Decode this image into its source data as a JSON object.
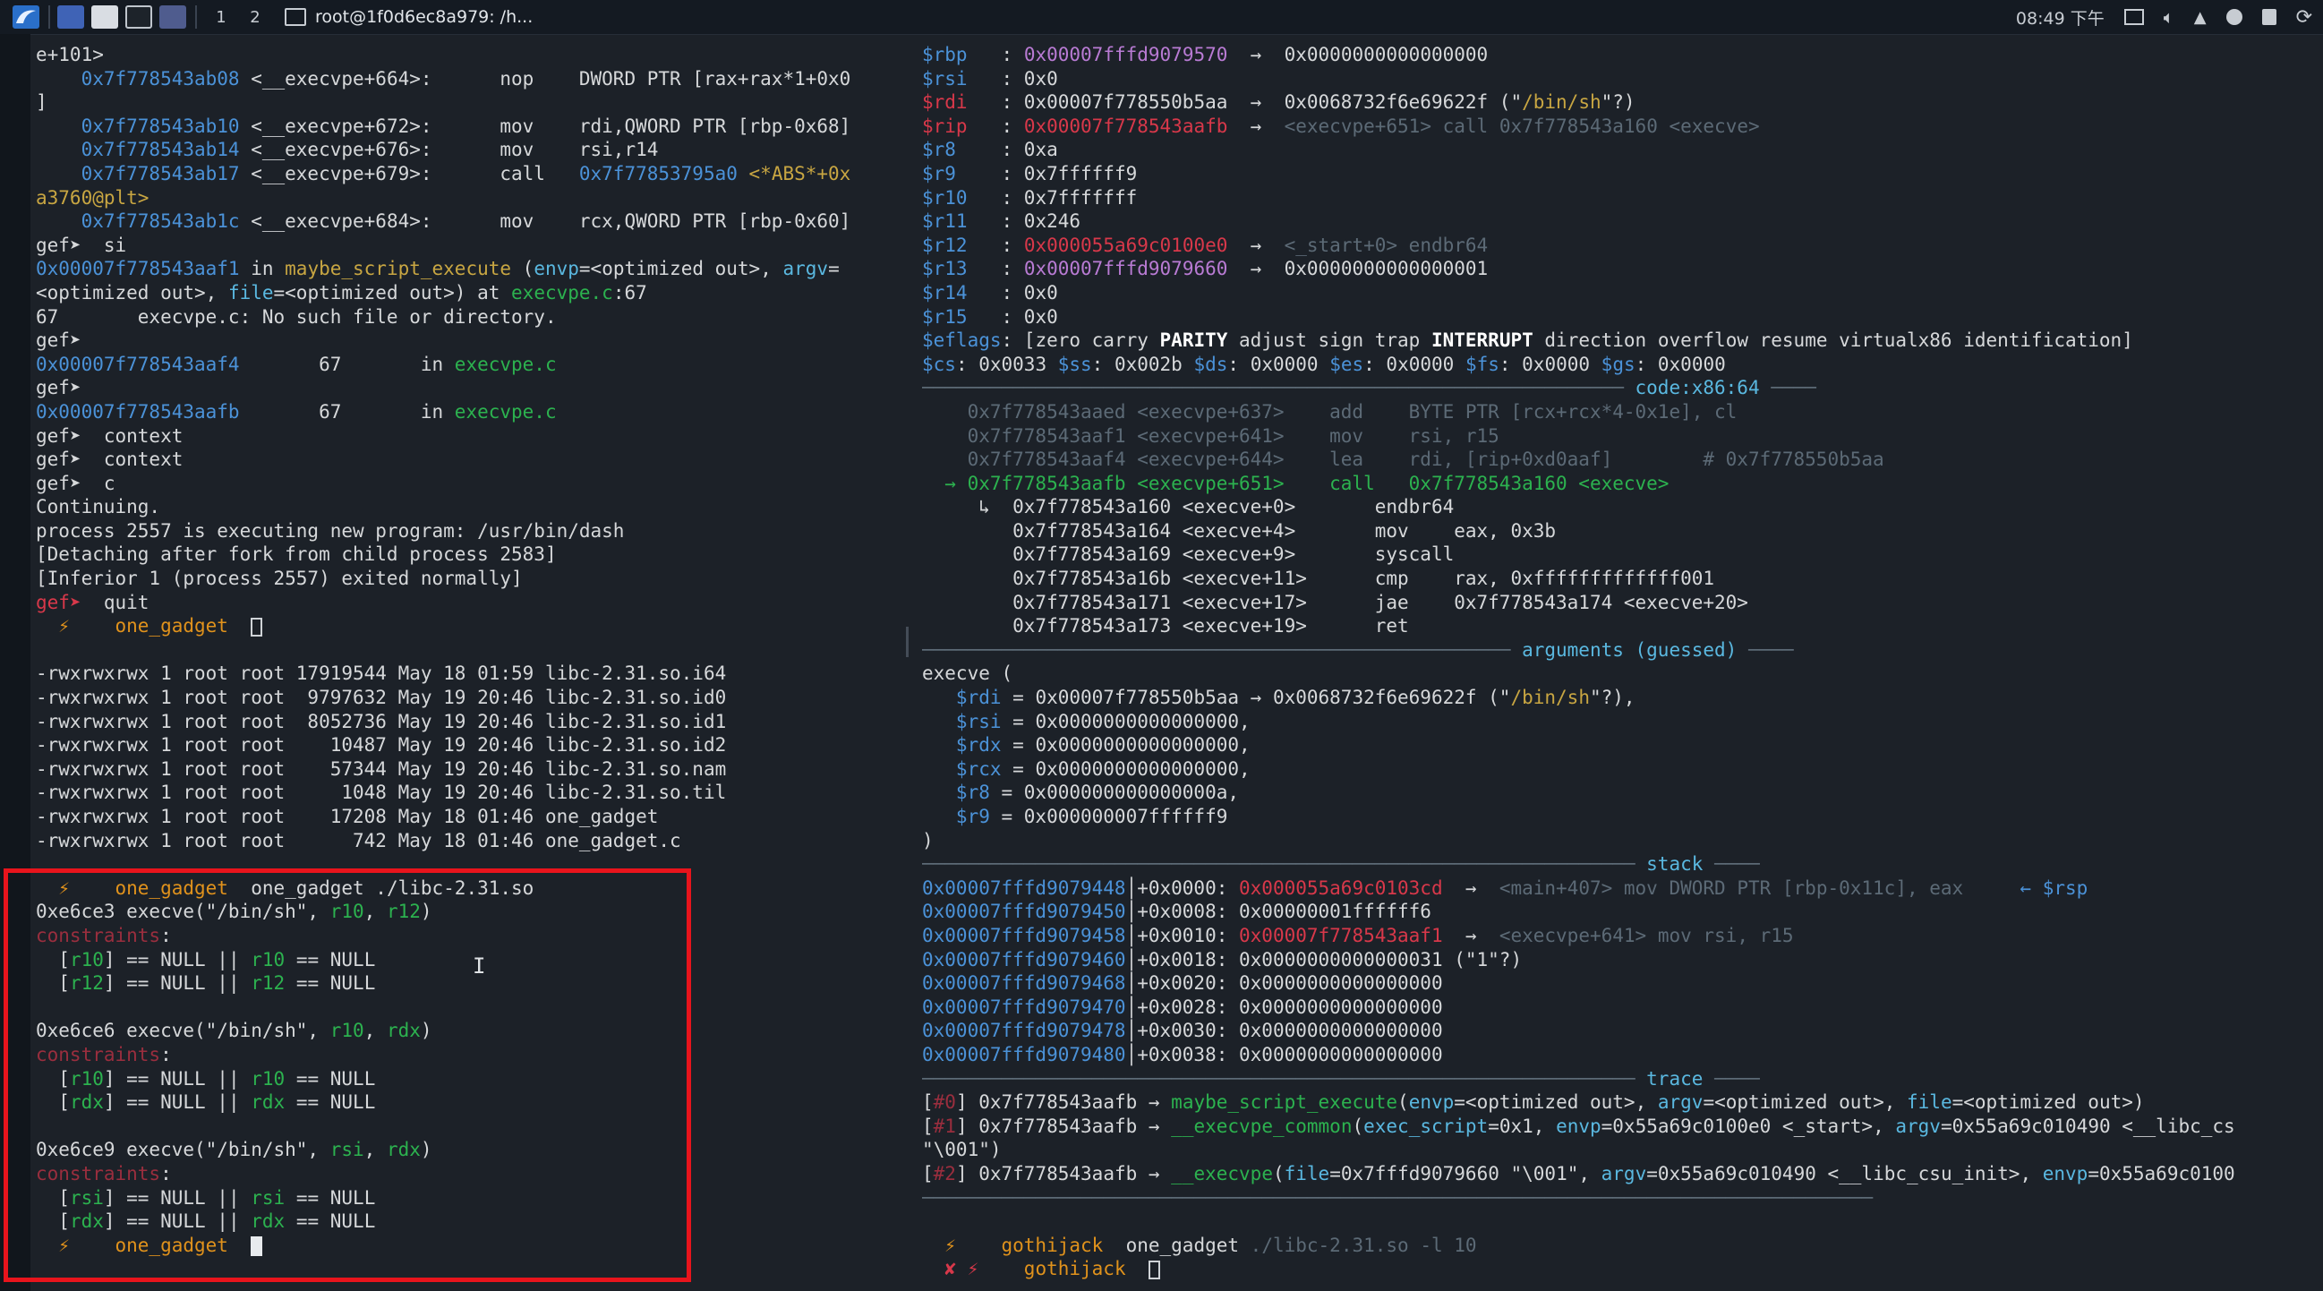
{
  "taskbar": {
    "workspaces": [
      "1",
      "2"
    ],
    "task_title": "root@1f0d6ec8a979: /h...",
    "clock": "08:49 下午"
  },
  "left_lines": [
    [
      [
        "e+101>",
        "w"
      ]
    ],
    [
      [
        "    0x7f778543ab08",
        "b"
      ],
      [
        " <__execvpe+664>:      nop    DWORD PTR [rax+rax*1+0x0",
        "w"
      ]
    ],
    [
      [
        "]",
        "w"
      ]
    ],
    [
      [
        "    0x7f778543ab10",
        "b"
      ],
      [
        " <__execvpe+672>:      mov    rdi,QWORD PTR [rbp-0x68]",
        "w"
      ]
    ],
    [
      [
        "    0x7f778543ab14",
        "b"
      ],
      [
        " <__execvpe+676>:      mov    rsi,r14",
        "w"
      ]
    ],
    [
      [
        "    0x7f778543ab17",
        "b"
      ],
      [
        " <__execvpe+679>:      call   ",
        "w"
      ],
      [
        "0x7f77853795a0",
        "b"
      ],
      [
        " <*ABS*+0x",
        "y"
      ]
    ],
    [
      [
        "a3760@plt>",
        "y"
      ]
    ],
    [
      [
        "    0x7f778543ab1c",
        "b"
      ],
      [
        " <__execvpe+684>:      mov    rcx,QWORD PTR [rbp-0x60]",
        "w"
      ]
    ],
    [
      [
        "gef➤ ",
        "w"
      ],
      [
        " si",
        "w"
      ]
    ],
    [
      [
        "0x00007f778543aaf1",
        "b"
      ],
      [
        " in ",
        "w"
      ],
      [
        "maybe_script_execute",
        "y"
      ],
      [
        " (",
        "w"
      ],
      [
        "envp",
        "c"
      ],
      [
        "=<optimized out>, ",
        "w"
      ],
      [
        "argv",
        "c"
      ],
      [
        "=",
        "w"
      ]
    ],
    [
      [
        "<optimized out>, ",
        "w"
      ],
      [
        "file",
        "c"
      ],
      [
        "=<optimized out>) at ",
        "w"
      ],
      [
        "execvpe.c",
        "g"
      ],
      [
        ":67",
        "w"
      ]
    ],
    [
      [
        "67       execvpe.c: No such file or directory.",
        "w"
      ]
    ],
    [
      [
        "gef➤ ",
        "w"
      ]
    ],
    [
      [
        "0x00007f778543aaf4",
        "b"
      ],
      [
        "       67       in ",
        "w"
      ],
      [
        "execvpe.c",
        "g"
      ]
    ],
    [
      [
        "gef➤ ",
        "w"
      ]
    ],
    [
      [
        "0x00007f778543aafb",
        "b"
      ],
      [
        "       67       in ",
        "w"
      ],
      [
        "execvpe.c",
        "g"
      ]
    ],
    [
      [
        "gef➤ ",
        "w"
      ],
      [
        " context",
        "w"
      ]
    ],
    [
      [
        "gef➤ ",
        "w"
      ],
      [
        " context",
        "w"
      ]
    ],
    [
      [
        "gef➤ ",
        "w"
      ],
      [
        " c",
        "w"
      ]
    ],
    [
      [
        "Continuing.",
        "w"
      ]
    ],
    [
      [
        "process 2557 is executing new program: /usr/bin/dash",
        "w"
      ]
    ],
    [
      [
        "[Detaching after fork from child process 2583]",
        "w"
      ]
    ],
    [
      [
        "[Inferior 1 (process 2557) exited normally]",
        "w"
      ]
    ],
    [
      [
        "gef➤ ",
        "r"
      ],
      [
        " quit",
        "w"
      ]
    ],
    [
      [
        "  ⚡  ",
        "o"
      ],
      [
        "  one_gadget  ",
        "o"
      ],
      [
        "CARET",
        "caret"
      ]
    ],
    [
      [
        "",
        "w"
      ]
    ],
    [
      [
        "-rwxrwxrwx 1 root root 17919544 May 18 01:59 libc-2.31.so.i64",
        "w"
      ]
    ],
    [
      [
        "-rwxrwxrwx 1 root root  9797632 May 19 20:46 libc-2.31.so.id0",
        "w"
      ]
    ],
    [
      [
        "-rwxrwxrwx 1 root root  8052736 May 19 20:46 libc-2.31.so.id1",
        "w"
      ]
    ],
    [
      [
        "-rwxrwxrwx 1 root root    10487 May 19 20:46 libc-2.31.so.id2",
        "w"
      ]
    ],
    [
      [
        "-rwxrwxrwx 1 root root    57344 May 19 20:46 libc-2.31.so.nam",
        "w"
      ]
    ],
    [
      [
        "-rwxrwxrwx 1 root root     1048 May 19 20:46 libc-2.31.so.til",
        "w"
      ]
    ],
    [
      [
        "-rwxrwxrwx 1 root root    17208 May 18 01:46 one_gadget",
        "w"
      ]
    ],
    [
      [
        "-rwxrwxrwx 1 root root      742 May 18 01:46 one_gadget.c",
        "w"
      ]
    ],
    [
      [
        "",
        "w"
      ]
    ],
    [
      [
        "  ⚡  ",
        "o"
      ],
      [
        "  one_gadget  ",
        "o"
      ],
      [
        "one_gadget ./libc-2.31.so",
        "w"
      ]
    ],
    [
      [
        "0xe6ce3 execve(\"/bin/sh\", ",
        "w"
      ],
      [
        "r10",
        "g"
      ],
      [
        ", ",
        "w"
      ],
      [
        "r12",
        "g"
      ],
      [
        ")",
        "w"
      ]
    ],
    [
      [
        "constraints",
        "dr"
      ],
      [
        ":",
        "w"
      ]
    ],
    [
      [
        "  [",
        "w"
      ],
      [
        "r10",
        "g"
      ],
      [
        "] == NULL || ",
        "w"
      ],
      [
        "r10",
        "g"
      ],
      [
        " == NULL",
        "w"
      ]
    ],
    [
      [
        "  [",
        "w"
      ],
      [
        "r12",
        "g"
      ],
      [
        "] == NULL || ",
        "w"
      ],
      [
        "r12",
        "g"
      ],
      [
        " == NULL",
        "w"
      ]
    ],
    [
      [
        "",
        "w"
      ]
    ],
    [
      [
        "0xe6ce6 execve(\"/bin/sh\", ",
        "w"
      ],
      [
        "r10",
        "g"
      ],
      [
        ", ",
        "w"
      ],
      [
        "rdx",
        "g"
      ],
      [
        ")",
        "w"
      ]
    ],
    [
      [
        "constraints",
        "dr"
      ],
      [
        ":",
        "w"
      ]
    ],
    [
      [
        "  [",
        "w"
      ],
      [
        "r10",
        "g"
      ],
      [
        "] == NULL || ",
        "w"
      ],
      [
        "r10",
        "g"
      ],
      [
        " == NULL",
        "w"
      ]
    ],
    [
      [
        "  [",
        "w"
      ],
      [
        "rdx",
        "g"
      ],
      [
        "] == NULL || ",
        "w"
      ],
      [
        "rdx",
        "g"
      ],
      [
        " == NULL",
        "w"
      ]
    ],
    [
      [
        "",
        "w"
      ]
    ],
    [
      [
        "0xe6ce9 execve(\"/bin/sh\", ",
        "w"
      ],
      [
        "rsi",
        "g"
      ],
      [
        ", ",
        "w"
      ],
      [
        "rdx",
        "g"
      ],
      [
        ")",
        "w"
      ]
    ],
    [
      [
        "constraints",
        "dr"
      ],
      [
        ":",
        "w"
      ]
    ],
    [
      [
        "  [",
        "w"
      ],
      [
        "rsi",
        "g"
      ],
      [
        "] == NULL || ",
        "w"
      ],
      [
        "rsi",
        "g"
      ],
      [
        " == NULL",
        "w"
      ]
    ],
    [
      [
        "  [",
        "w"
      ],
      [
        "rdx",
        "g"
      ],
      [
        "] == NULL || ",
        "w"
      ],
      [
        "rdx",
        "g"
      ],
      [
        " == NULL",
        "w"
      ]
    ],
    [
      [
        "  ⚡  ",
        "o"
      ],
      [
        "  one_gadget  ",
        "o"
      ],
      [
        "CARETFILL",
        "caret"
      ]
    ]
  ],
  "right_lines": [
    [
      [
        "$rbp   ",
        "b"
      ],
      [
        ": ",
        "w"
      ],
      [
        "0x00007fffd9079570",
        "m"
      ],
      [
        "  →  0x0000000000000000",
        "w"
      ]
    ],
    [
      [
        "$rsi   ",
        "b"
      ],
      [
        ": 0x0",
        "w"
      ]
    ],
    [
      [
        "$rdi   ",
        "r"
      ],
      [
        ": 0x00007f778550b5aa  →  0x0068732f6e69622f (\"",
        "w"
      ],
      [
        "/bin/sh",
        "y"
      ],
      [
        "\"?)",
        "w"
      ]
    ],
    [
      [
        "$rip   ",
        "r"
      ],
      [
        ": ",
        "w"
      ],
      [
        "0x00007f778543aafb",
        "r"
      ],
      [
        "  →  ",
        "w"
      ],
      [
        "<execvpe+651> call 0x7f778543a160 <execve>",
        "dim"
      ]
    ],
    [
      [
        "$r8    ",
        "b"
      ],
      [
        ": 0xa",
        "w"
      ]
    ],
    [
      [
        "$r9    ",
        "b"
      ],
      [
        ": 0x7ffffff9",
        "w"
      ]
    ],
    [
      [
        "$r10   ",
        "b"
      ],
      [
        ": 0x7fffffff",
        "w"
      ]
    ],
    [
      [
        "$r11   ",
        "b"
      ],
      [
        ": 0x246",
        "w"
      ]
    ],
    [
      [
        "$r12   ",
        "b"
      ],
      [
        ": ",
        "w"
      ],
      [
        "0x000055a69c0100e0",
        "r"
      ],
      [
        "  →  ",
        "w"
      ],
      [
        "<_start+0> endbr64",
        "dim"
      ]
    ],
    [
      [
        "$r13   ",
        "b"
      ],
      [
        ": ",
        "w"
      ],
      [
        "0x00007fffd9079660",
        "m"
      ],
      [
        "  →  0x0000000000000001",
        "w"
      ]
    ],
    [
      [
        "$r14   ",
        "b"
      ],
      [
        ": 0x0",
        "w"
      ]
    ],
    [
      [
        "$r15   ",
        "b"
      ],
      [
        ": 0x0",
        "w"
      ]
    ],
    [
      [
        "$eflags",
        "b"
      ],
      [
        ": [zero carry ",
        "w"
      ],
      [
        "PARITY",
        "bold"
      ],
      [
        " adjust sign trap ",
        "w"
      ],
      [
        "INTERRUPT",
        "bold"
      ],
      [
        " direction overflow resume virtualx86 identification]",
        "w"
      ]
    ],
    [
      [
        "$cs",
        "b"
      ],
      [
        ": 0x0033 ",
        "w"
      ],
      [
        "$ss",
        "b"
      ],
      [
        ": 0x002b ",
        "w"
      ],
      [
        "$ds",
        "b"
      ],
      [
        ": 0x0000 ",
        "w"
      ],
      [
        "$es",
        "b"
      ],
      [
        ": 0x0000 ",
        "w"
      ],
      [
        "$fs",
        "b"
      ],
      [
        ": 0x0000 ",
        "w"
      ],
      [
        "$gs",
        "b"
      ],
      [
        ": 0x0000",
        "w"
      ]
    ],
    [
      [
        "────────────────────────────────────────────────────────────── ",
        "hdr"
      ],
      [
        "code:x86:64",
        "c"
      ],
      [
        " ────",
        "hdr"
      ]
    ],
    [
      [
        "    0x7f778543aaed <execvpe+637>    add    BYTE PTR [rcx+rcx*4-0x1e], cl",
        "dim"
      ]
    ],
    [
      [
        "    0x7f778543aaf1 <execvpe+641>    mov    rsi, r15",
        "dim"
      ]
    ],
    [
      [
        "    0x7f778543aaf4 <execvpe+644>    lea    rdi, [rip+0xd0aaf]        # 0x7f778550b5aa",
        "dim"
      ]
    ],
    [
      [
        "  → 0x7f778543aafb <execvpe+651>    call   0x7f778543a160 <execve>",
        "g"
      ]
    ],
    [
      [
        "     ↳  0x7f778543a160 <execve+0>       endbr64",
        "w"
      ]
    ],
    [
      [
        "        0x7f778543a164 <execve+4>       mov    eax, 0x3b",
        "w"
      ]
    ],
    [
      [
        "        0x7f778543a169 <execve+9>       syscall",
        "w"
      ]
    ],
    [
      [
        "        0x7f778543a16b <execve+11>      cmp    rax, 0xfffffffffffff001",
        "w"
      ]
    ],
    [
      [
        "        0x7f778543a171 <execve+17>      jae    0x7f778543a174 <execve+20>",
        "w"
      ]
    ],
    [
      [
        "        0x7f778543a173 <execve+19>      ret",
        "w"
      ]
    ],
    [
      [
        "──────────────────────────────────────────────────── ",
        "hdr"
      ],
      [
        "arguments (guessed)",
        "c"
      ],
      [
        " ────",
        "hdr"
      ]
    ],
    [
      [
        "execve (",
        "w"
      ]
    ],
    [
      [
        "   $rdi",
        "b"
      ],
      [
        " = 0x00007f778550b5aa → 0x0068732f6e69622f (\"",
        "w"
      ],
      [
        "/bin/sh",
        "y"
      ],
      [
        "\"?),",
        "w"
      ]
    ],
    [
      [
        "   $rsi",
        "b"
      ],
      [
        " = 0x0000000000000000,",
        "w"
      ]
    ],
    [
      [
        "   $rdx",
        "b"
      ],
      [
        " = 0x0000000000000000,",
        "w"
      ]
    ],
    [
      [
        "   $rcx",
        "b"
      ],
      [
        " = 0x0000000000000000,",
        "w"
      ]
    ],
    [
      [
        "   $r8",
        "b"
      ],
      [
        " = 0x000000000000000a,",
        "w"
      ]
    ],
    [
      [
        "   $r9",
        "b"
      ],
      [
        " = 0x000000007ffffff9",
        "w"
      ]
    ],
    [
      [
        ")",
        "w"
      ]
    ],
    [
      [
        "─────────────────────────────────────────────────────────────── ",
        "hdr"
      ],
      [
        "stack",
        "c"
      ],
      [
        " ────",
        "hdr"
      ]
    ],
    [
      [
        "0x00007fffd9079448",
        "b"
      ],
      [
        "│+0x0000: ",
        "w"
      ],
      [
        "0x000055a69c0103cd",
        "r"
      ],
      [
        "  →  ",
        "w"
      ],
      [
        "<main+407> mov DWORD PTR [rbp-0x11c], eax",
        "dim"
      ],
      [
        "     ← $rsp",
        "b"
      ]
    ],
    [
      [
        "0x00007fffd9079450",
        "b"
      ],
      [
        "│+0x0008: 0x00000001ffffff6",
        "w"
      ]
    ],
    [
      [
        "0x00007fffd9079458",
        "b"
      ],
      [
        "│+0x0010: ",
        "w"
      ],
      [
        "0x00007f778543aaf1",
        "r"
      ],
      [
        "  →  ",
        "w"
      ],
      [
        "<execvpe+641> mov rsi, r15",
        "dim"
      ]
    ],
    [
      [
        "0x00007fffd9079460",
        "b"
      ],
      [
        "│+0x0018: 0x0000000000000031 (\"1\"?)",
        "w"
      ]
    ],
    [
      [
        "0x00007fffd9079468",
        "b"
      ],
      [
        "│+0x0020: 0x0000000000000000",
        "w"
      ]
    ],
    [
      [
        "0x00007fffd9079470",
        "b"
      ],
      [
        "│+0x0028: 0x0000000000000000",
        "w"
      ]
    ],
    [
      [
        "0x00007fffd9079478",
        "b"
      ],
      [
        "│+0x0030: 0x0000000000000000",
        "w"
      ]
    ],
    [
      [
        "0x00007fffd9079480",
        "b"
      ],
      [
        "│+0x0038: 0x0000000000000000",
        "w"
      ]
    ],
    [
      [
        "─────────────────────────────────────────────────────────────── ",
        "hdr"
      ],
      [
        "trace",
        "c"
      ],
      [
        " ────",
        "hdr"
      ]
    ],
    [
      [
        "[",
        "w"
      ],
      [
        "#0",
        "dr"
      ],
      [
        "] 0x7f778543aafb → ",
        "w"
      ],
      [
        "maybe_script_execute",
        "g"
      ],
      [
        "(",
        "w"
      ],
      [
        "envp",
        "c"
      ],
      [
        "=<optimized out>, ",
        "w"
      ],
      [
        "argv",
        "c"
      ],
      [
        "=<optimized out>, ",
        "w"
      ],
      [
        "file",
        "c"
      ],
      [
        "=<optimized out>)",
        "w"
      ]
    ],
    [
      [
        "[",
        "w"
      ],
      [
        "#1",
        "dr"
      ],
      [
        "] 0x7f778543aafb → ",
        "w"
      ],
      [
        "__execvpe_common",
        "g"
      ],
      [
        "(",
        "w"
      ],
      [
        "exec_script",
        "c"
      ],
      [
        "=0x1, ",
        "w"
      ],
      [
        "envp",
        "c"
      ],
      [
        "=0x55a69c0100e0 <_start>, ",
        "w"
      ],
      [
        "argv",
        "c"
      ],
      [
        "=0x55a69c010490 <__libc_cs",
        "w"
      ]
    ],
    [
      [
        "\"\\001\")",
        "w"
      ]
    ],
    [
      [
        "[",
        "w"
      ],
      [
        "#2",
        "dr"
      ],
      [
        "] 0x7f778543aafb → ",
        "w"
      ],
      [
        "__execvpe",
        "g"
      ],
      [
        "(",
        "w"
      ],
      [
        "file",
        "c"
      ],
      [
        "=0x7fffd9079660 \"\\001\", ",
        "w"
      ],
      [
        "argv",
        "c"
      ],
      [
        "=0x55a69c010490 <__libc_csu_init>, ",
        "w"
      ],
      [
        "envp",
        "c"
      ],
      [
        "=0x55a69c0100",
        "w"
      ]
    ],
    [
      [
        "────────────────────────────────────────────────────────────────────────────────────",
        "hdr"
      ]
    ],
    [
      [
        "",
        "w"
      ]
    ],
    [
      [
        "  ⚡  ",
        "o"
      ],
      [
        "  gothijack  ",
        "o"
      ],
      [
        "one_gadget ",
        "w"
      ],
      [
        "./libc-2.31.so -l 10",
        "dim"
      ]
    ],
    [
      [
        "  ✘ ⚡  ",
        "r"
      ],
      [
        "  gothijack  ",
        "o"
      ],
      [
        "CARET",
        "caret"
      ]
    ]
  ]
}
